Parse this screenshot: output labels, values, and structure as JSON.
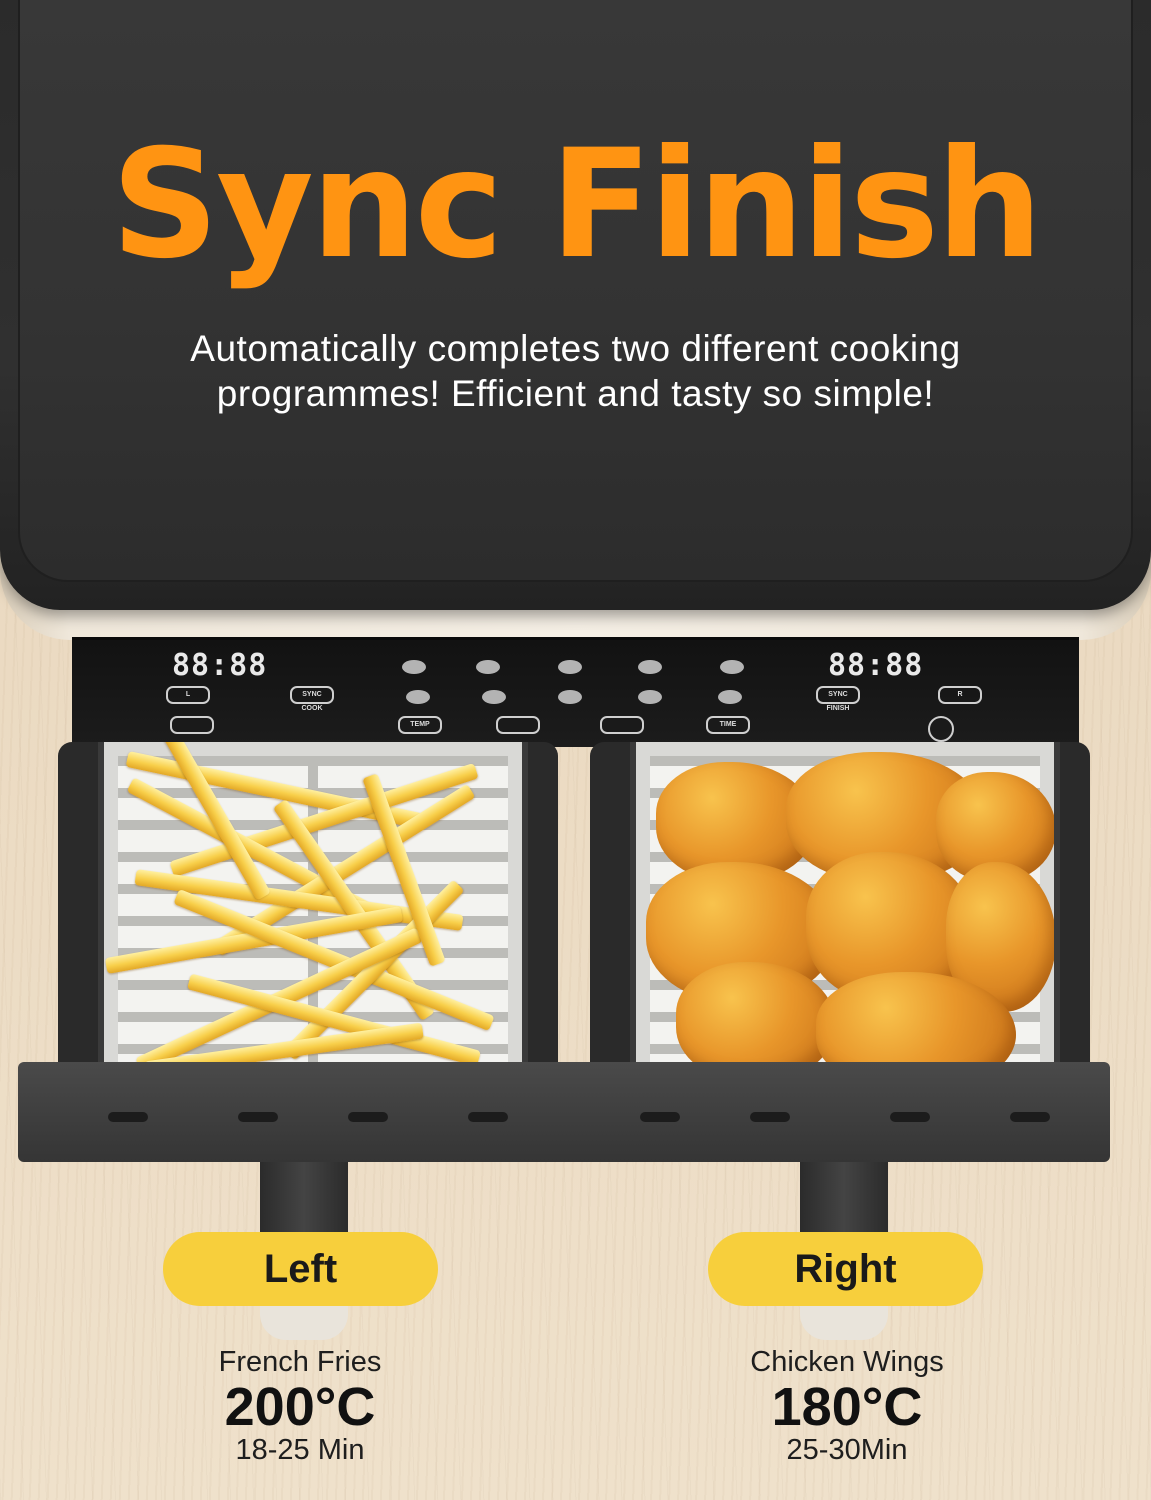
{
  "headline": "Sync Finish",
  "subheadline_lines": [
    "Automatically completes two different cooking",
    "programmes! Efficient and tasty so simple!"
  ],
  "panel": {
    "left_display": "88:88",
    "right_display": "88:88",
    "left_buttons": [
      "L",
      "SYNC COOK",
      "TEMP"
    ],
    "right_buttons": [
      "SYNC FINISH",
      "R",
      "TIME"
    ]
  },
  "baskets": {
    "left": {
      "label": "Left",
      "food": "French Fries",
      "temperature": "200°C",
      "time": "18-25 Min"
    },
    "right": {
      "label": "Right",
      "food": "Chicken Wings",
      "temperature": "180°C",
      "time": "25-30Min"
    }
  },
  "colors": {
    "headline": "#ff9412",
    "pill": "#f7cf3c",
    "lid": "#333333"
  }
}
